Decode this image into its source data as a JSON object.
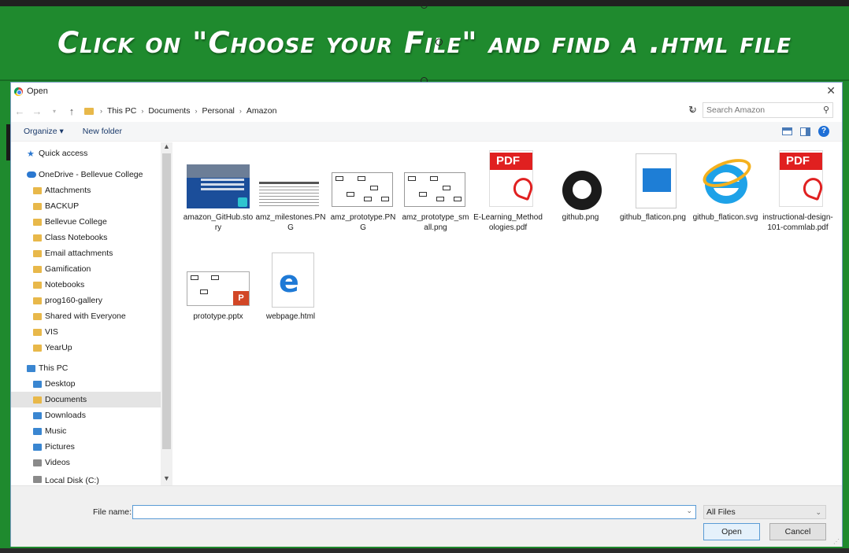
{
  "banner": {
    "text": "Click on \"Choose your File\" and find a .html file"
  },
  "dialog": {
    "title": "Open",
    "close_icon": "close-icon",
    "breadcrumb": [
      "This PC",
      "Documents",
      "Personal",
      "Amazon"
    ],
    "search_placeholder": "Search Amazon",
    "organize_label": "Organize ▾",
    "new_folder_label": "New folder",
    "help_label": "?"
  },
  "sidebar": {
    "items": [
      {
        "label": "Quick access",
        "icon": "star-icon"
      },
      {
        "label": "OneDrive - Bellevue College",
        "icon": "cloud-icon"
      },
      {
        "label": "Attachments",
        "icon": "folder-icon"
      },
      {
        "label": "BACKUP",
        "icon": "folder-icon"
      },
      {
        "label": "Bellevue College",
        "icon": "folder-icon"
      },
      {
        "label": "Class Notebooks",
        "icon": "folder-icon"
      },
      {
        "label": "Email attachments",
        "icon": "folder-icon"
      },
      {
        "label": "Gamification",
        "icon": "folder-icon"
      },
      {
        "label": "Notebooks",
        "icon": "folder-icon"
      },
      {
        "label": "prog160-gallery",
        "icon": "folder-icon"
      },
      {
        "label": "Shared with Everyone",
        "icon": "folder-icon"
      },
      {
        "label": "VIS",
        "icon": "folder-icon"
      },
      {
        "label": "YearUp",
        "icon": "folder-icon"
      },
      {
        "label": "This PC",
        "icon": "pc-icon"
      },
      {
        "label": "Desktop",
        "icon": "folder-icon"
      },
      {
        "label": "Documents",
        "icon": "folder-icon"
      },
      {
        "label": "Downloads",
        "icon": "folder-icon"
      },
      {
        "label": "Music",
        "icon": "folder-icon"
      },
      {
        "label": "Pictures",
        "icon": "folder-icon"
      },
      {
        "label": "Videos",
        "icon": "folder-icon"
      },
      {
        "label": "Local Disk (C:)",
        "icon": "disk-icon"
      }
    ],
    "selected": "Documents"
  },
  "files": [
    {
      "name": "amazon_GitHub.story",
      "kind": "image-thumbnail"
    },
    {
      "name": "amz_milestones.PNG",
      "kind": "spreadsheet-thumbnail"
    },
    {
      "name": "amz_prototype.PNG",
      "kind": "wireframe-thumbnail"
    },
    {
      "name": "amz_prototype_small.png",
      "kind": "wireframe-thumbnail"
    },
    {
      "name": "E-Learning_Methodologies.pdf",
      "kind": "pdf-icon"
    },
    {
      "name": "github.png",
      "kind": "github-icon"
    },
    {
      "name": "github_flaticon.png",
      "kind": "image-file-icon"
    },
    {
      "name": "github_flaticon.svg",
      "kind": "ie-icon"
    },
    {
      "name": "instructional-design-101-commlab.pdf",
      "kind": "pdf-icon"
    },
    {
      "name": "prototype.pptx",
      "kind": "pptx-thumbnail"
    },
    {
      "name": "webpage.html",
      "kind": "edge-icon"
    }
  ],
  "thumb_text": {
    "pdf_tag": "PDF",
    "pptx_badge": "P"
  },
  "footer": {
    "file_name_label": "File name:",
    "file_name_value": "",
    "filter_value": "All Files",
    "open_label": "Open",
    "cancel_label": "Cancel"
  },
  "colors": {
    "banner_green": "#1f8a2e",
    "accent_blue": "#5a9bd5",
    "pdf_red": "#e02020"
  }
}
